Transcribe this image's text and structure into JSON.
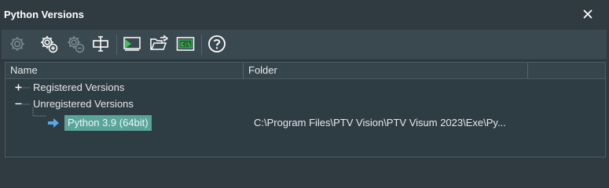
{
  "window": {
    "title": "Python Versions"
  },
  "toolbar": {
    "buttons": [
      {
        "name": "settings",
        "icon": "gear-icon",
        "enabled": false
      },
      {
        "name": "add-settings",
        "icon": "gear-add-icon",
        "enabled": true
      },
      {
        "name": "remove-settings",
        "icon": "gear-remove-icon",
        "enabled": false
      },
      {
        "name": "text-cursor",
        "icon": "text-cursor-icon",
        "enabled": true
      },
      {
        "name": "run",
        "icon": "run-screen-icon",
        "enabled": true
      },
      {
        "name": "open-folder",
        "icon": "open-folder-icon",
        "enabled": true
      },
      {
        "name": "console",
        "icon": "console-icon",
        "enabled": true
      },
      {
        "name": "help",
        "icon": "help-icon",
        "enabled": true
      }
    ]
  },
  "tree": {
    "columns": [
      "Name",
      "Folder"
    ],
    "nodes": {
      "registered": {
        "label": "Registered Versions",
        "expander": "+"
      },
      "unregistered": {
        "label": "Unregistered Versions",
        "expander": "−"
      },
      "python39": {
        "label": "Python 3.9 (64bit)",
        "folder": "C:\\Program Files\\PTV Vision\\PTV Visum 2023\\Exe\\Py..."
      }
    }
  },
  "colors": {
    "background": "#2f3b41",
    "toolbar": "#3a4850",
    "selection": "#5aa59b",
    "accent_green": "#3fbf5a",
    "arrow_blue": "#5aa9e6"
  }
}
